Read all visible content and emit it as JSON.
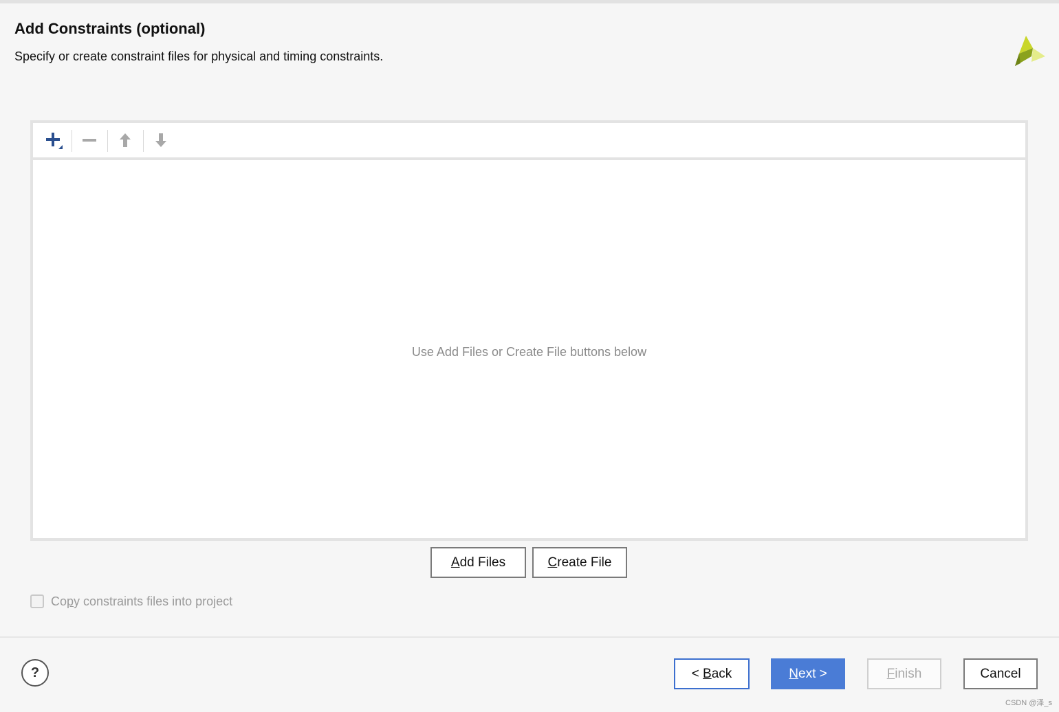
{
  "header": {
    "title": "Add Constraints (optional)",
    "subtitle": "Specify or create constraint files for physical and timing constraints."
  },
  "logo": {
    "icon": "vivado-logo-icon",
    "colors": [
      "#8ba21d",
      "#c9d62a",
      "#e4ec8a"
    ]
  },
  "toolbar": {
    "items": [
      {
        "icon": "add-icon",
        "enabled": true
      },
      {
        "icon": "remove-icon",
        "enabled": false
      },
      {
        "icon": "move-up-icon",
        "enabled": false
      },
      {
        "icon": "move-down-icon",
        "enabled": false
      }
    ]
  },
  "file_list": {
    "empty_hint": "Use Add Files or Create File buttons below"
  },
  "actions": {
    "add_files": {
      "accel": "A",
      "rest": "dd Files"
    },
    "create_file": {
      "accel": "C",
      "rest": "reate File"
    }
  },
  "copy_option": {
    "pre": "Co",
    "accel": "p",
    "post": "y constraints files into project",
    "checked": false,
    "enabled": false
  },
  "footer": {
    "help_label": "?",
    "back": {
      "pre": "< ",
      "accel": "B",
      "post": "ack"
    },
    "next": {
      "accel": "N",
      "post": "ext >"
    },
    "finish": {
      "accel": "F",
      "post": "inish",
      "enabled": false
    },
    "cancel_label": "Cancel"
  },
  "watermark": "CSDN @泽_s",
  "colors": {
    "primary": "#4a7cd6",
    "focus_border": "#3c6fcf",
    "add_icon": "#2a4f8f",
    "disabled_icon": "#a8a8a8"
  }
}
